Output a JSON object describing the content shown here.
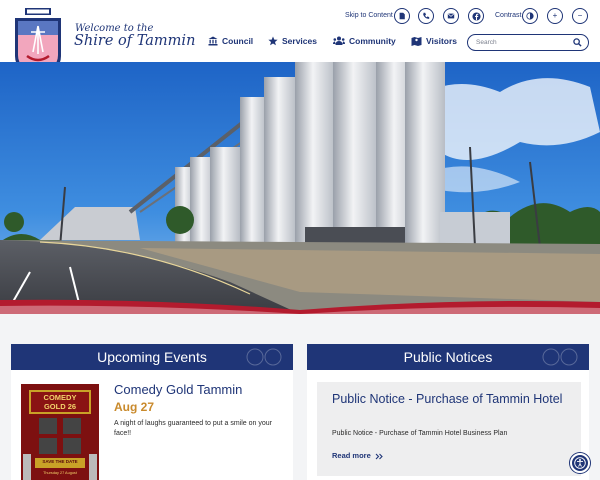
{
  "header": {
    "welcome": "Welcome to the",
    "shire_name": "Shire of Tammin"
  },
  "utility": {
    "skip_label": "Skip to Content",
    "contrast_label": "Contrast",
    "zoom_in_symbol": "+",
    "zoom_out_symbol": "−"
  },
  "nav": {
    "items": [
      {
        "label": "Council",
        "icon": "building-icon"
      },
      {
        "label": "Services",
        "icon": "star-icon"
      },
      {
        "label": "Community",
        "icon": "people-icon"
      },
      {
        "label": "Visitors",
        "icon": "map-icon"
      }
    ]
  },
  "search": {
    "placeholder": "Search"
  },
  "events": {
    "heading": "Upcoming Events",
    "poster": {
      "line1": "COMEDY",
      "line2": "GOLD 26",
      "save": "SAVE THE DATE",
      "sub": "Thursday 27 August"
    },
    "item": {
      "title": "Comedy Gold Tammin",
      "date": "Aug 27",
      "description": "A night of laughs guaranteed to put a smile on your face!!"
    }
  },
  "notices": {
    "heading": "Public Notices",
    "item": {
      "title": "Public Notice - Purchase of Tammin Hotel",
      "description": "Public Notice - Purchase of Tammin Hotel Business Plan",
      "read_more": "Read more"
    }
  },
  "colors": {
    "brand_navy": "#1f3577",
    "accent_red": "#b31b2e",
    "event_date": "#c98a2c"
  }
}
